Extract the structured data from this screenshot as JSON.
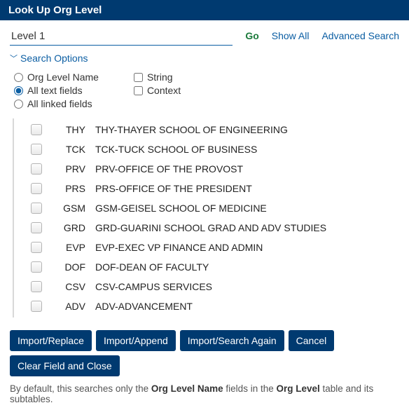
{
  "header": {
    "title": "Look Up Org Level"
  },
  "search": {
    "value": "Level 1",
    "go": "Go",
    "show_all": "Show All",
    "advanced": "Advanced Search"
  },
  "toggle_label": "Search Options",
  "options": {
    "col1": {
      "name": "Org Level Name",
      "all_text": "All text fields",
      "all_linked": "All linked fields"
    },
    "col2": {
      "string": "String",
      "context": "Context"
    }
  },
  "rows": [
    {
      "code": "THY",
      "desc": "THY-THAYER SCHOOL OF ENGINEERING"
    },
    {
      "code": "TCK",
      "desc": "TCK-TUCK SCHOOL OF BUSINESS"
    },
    {
      "code": "PRV",
      "desc": "PRV-OFFICE OF THE PROVOST"
    },
    {
      "code": "PRS",
      "desc": "PRS-OFFICE OF THE PRESIDENT"
    },
    {
      "code": "GSM",
      "desc": "GSM-GEISEL SCHOOL OF MEDICINE"
    },
    {
      "code": "GRD",
      "desc": "GRD-GUARINI SCHOOL GRAD AND ADV STUDIES"
    },
    {
      "code": "EVP",
      "desc": "EVP-EXEC VP FINANCE AND ADMIN"
    },
    {
      "code": "DOF",
      "desc": "DOF-DEAN OF FACULTY"
    },
    {
      "code": "CSV",
      "desc": "CSV-CAMPUS SERVICES"
    },
    {
      "code": "ADV",
      "desc": "ADV-ADVANCEMENT"
    }
  ],
  "buttons": {
    "import_replace": "Import/Replace",
    "import_append": "Import/Append",
    "import_search": "Import/Search Again",
    "cancel": "Cancel",
    "clear_close": "Clear Field and Close"
  },
  "footer": {
    "p1": "By default, this searches only the ",
    "b1": "Org Level Name",
    "p2": " fields in the ",
    "b2": "Org Level",
    "p3": " table and its subtables."
  }
}
